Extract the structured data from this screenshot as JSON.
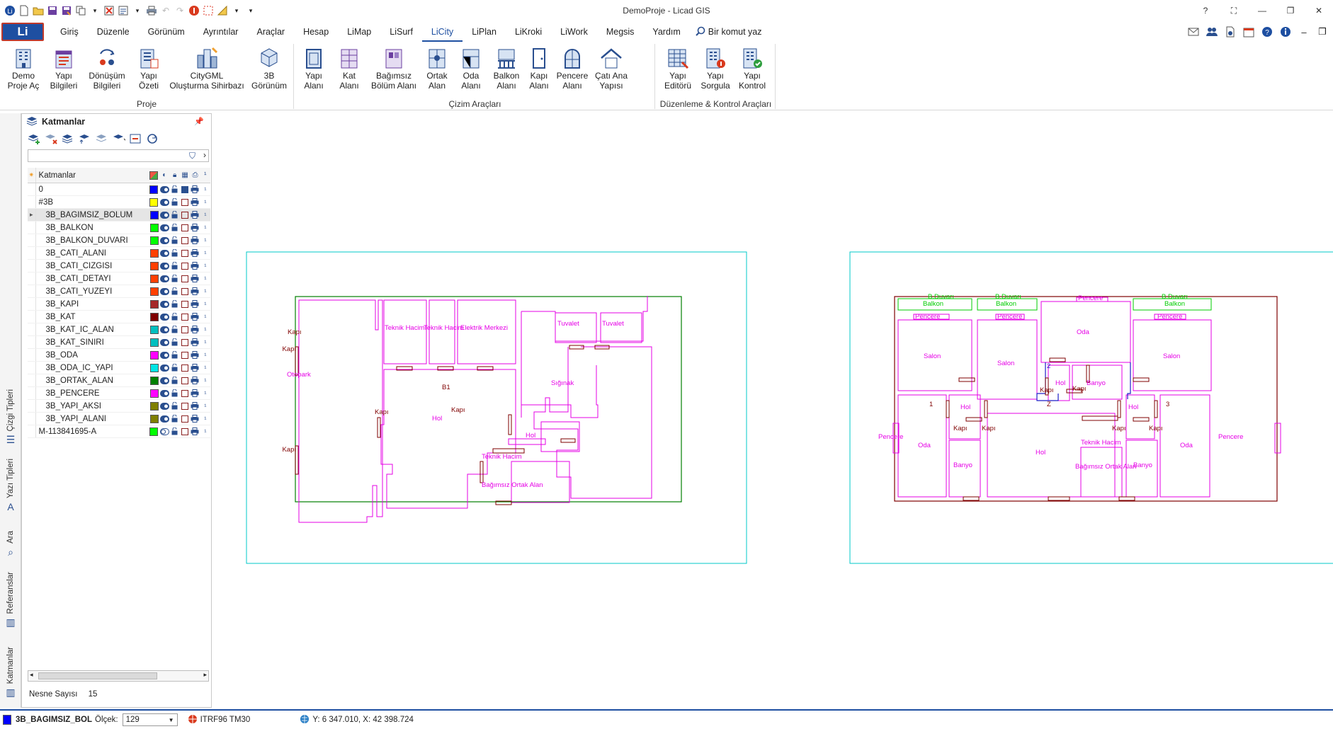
{
  "window": {
    "title": "DemoProje - Licad GIS"
  },
  "menu": {
    "app_button": "Li",
    "tabs": [
      "Giriş",
      "Düzenle",
      "Görünüm",
      "Ayrıntılar",
      "Araçlar",
      "Hesap",
      "LiMap",
      "LiSurf",
      "LiCity",
      "LiPlan",
      "LiKroki",
      "LiWork",
      "Megsis",
      "Yardım"
    ],
    "active_tab": "LiCity",
    "command_search": "Bir komut yaz"
  },
  "ribbon": {
    "groups": [
      {
        "label": "Proje",
        "buttons": [
          "Demo\nProje Aç",
          "Yapı\nBilgileri",
          "Dönüşüm\nBilgileri",
          "Yapı\nÖzeti",
          "CityGML\nOluşturma Sihirbazı",
          "3B\nGörünüm"
        ]
      },
      {
        "label": "Çizim Araçları",
        "buttons": [
          "Yapı\nAlanı",
          "Kat\nAlanı",
          "Bağımsız\nBölüm Alanı",
          "Ortak\nAlan",
          "Oda\nAlanı",
          "Balkon\nAlanı",
          "Kapı\nAlanı",
          "Pencere\nAlanı",
          "Çatı Ana\nYapısı"
        ]
      },
      {
        "label": "Düzenleme & Kontrol Araçları",
        "buttons": [
          "Yapı\nEditörü",
          "Yapı\nSorgula",
          "Yapı\nKontrol"
        ]
      }
    ]
  },
  "side_tabs": [
    "Çizgi Tipleri",
    "Yazı Tipleri",
    "Ara",
    "Referanslar",
    "Katmanlar"
  ],
  "layers_panel": {
    "title": "Katmanlar",
    "column_header": "Katmanlar",
    "object_count_label": "Nesne Sayısı",
    "object_count": "15",
    "rows": [
      {
        "name": "0",
        "color": "#0000ff",
        "indent": false,
        "selected": false,
        "visible": true
      },
      {
        "name": "#3B",
        "color": "#ffff00",
        "indent": false,
        "selected": false,
        "visible": true
      },
      {
        "name": "3B_BAGIMSIZ_BOLUM",
        "color": "#0000ff",
        "indent": true,
        "selected": true,
        "visible": true
      },
      {
        "name": "3B_BALKON",
        "color": "#00ff00",
        "indent": true,
        "selected": false,
        "visible": true
      },
      {
        "name": "3B_BALKON_DUVARI",
        "color": "#00ff00",
        "indent": true,
        "selected": false,
        "visible": true
      },
      {
        "name": "3B_CATI_ALANI",
        "color": "#ff4000",
        "indent": true,
        "selected": false,
        "visible": true
      },
      {
        "name": "3B_CATI_CIZGISI",
        "color": "#ff4000",
        "indent": true,
        "selected": false,
        "visible": true
      },
      {
        "name": "3B_CATI_DETAYI",
        "color": "#ff4000",
        "indent": true,
        "selected": false,
        "visible": true
      },
      {
        "name": "3B_CATI_YUZEYI",
        "color": "#ff4000",
        "indent": true,
        "selected": false,
        "visible": true
      },
      {
        "name": "3B_KAPI",
        "color": "#a52a2a",
        "indent": true,
        "selected": false,
        "visible": true
      },
      {
        "name": "3B_KAT",
        "color": "#7f0000",
        "indent": true,
        "selected": false,
        "visible": true
      },
      {
        "name": "3B_KAT_IC_ALAN",
        "color": "#00bfbf",
        "indent": true,
        "selected": false,
        "visible": true
      },
      {
        "name": "3B_KAT_SINIRI",
        "color": "#00bfbf",
        "indent": true,
        "selected": false,
        "visible": true
      },
      {
        "name": "3B_ODA",
        "color": "#ff00ff",
        "indent": true,
        "selected": false,
        "visible": true
      },
      {
        "name": "3B_ODA_IC_YAPI",
        "color": "#00e5e5",
        "indent": true,
        "selected": false,
        "visible": true
      },
      {
        "name": "3B_ORTAK_ALAN",
        "color": "#007f00",
        "indent": true,
        "selected": false,
        "visible": true
      },
      {
        "name": "3B_PENCERE",
        "color": "#ff00ff",
        "indent": true,
        "selected": false,
        "visible": true
      },
      {
        "name": "3B_YAPI_AKSI",
        "color": "#7f7f00",
        "indent": true,
        "selected": false,
        "visible": true
      },
      {
        "name": "3B_YAPI_ALANI",
        "color": "#7f7f00",
        "indent": true,
        "selected": false,
        "visible": true
      },
      {
        "name": "M-113841695-A",
        "color": "#00ff00",
        "indent": false,
        "selected": false,
        "visible": false
      }
    ]
  },
  "plan_left": {
    "labels": {
      "otopark": "Otopark",
      "teknik1": "Teknik Hacim",
      "teknik2": "Teknik Hacim",
      "elektrik": "Elektrik Merkezi",
      "tuvalet1": "Tuvalet",
      "tuvalet2": "Tuvalet",
      "b1": "B1",
      "hol1": "Hol",
      "hol2": "Hol",
      "siginak": "Sığınak",
      "teknik3": "Teknik Hacim",
      "ortak": "Bağımsız Ortak Alan",
      "kapi": "Kapı"
    }
  },
  "plan_right": {
    "labels": {
      "bduvari": "B.Duvarı",
      "balkon": "Balkon",
      "pencere": "Pencere",
      "salon": "Salon",
      "oda": "Oda",
      "hol": "Hol",
      "banyo": "Banyo",
      "kapi": "Kapı",
      "teknik": "Teknik Hacim",
      "ortak": "Bağımsız Ortak Alan",
      "n1": "1",
      "n2": "2",
      "n3": "3",
      "z": "Z"
    }
  },
  "status": {
    "layer": "3B_BAGIMSIZ_BOL",
    "layer_color": "#0000ff",
    "scale_label": "Ölçek:",
    "scale_value": "129",
    "crs": "ITRF96 TM30",
    "coords": "Y: 6 347.010, X: 42 398.724"
  },
  "colors": {
    "accent": "#1e4fa1",
    "room": "#e600e6",
    "wall": "#7f0000",
    "border": "#00c8c8",
    "ortak": "#007f00",
    "balkon": "#00cc00"
  }
}
